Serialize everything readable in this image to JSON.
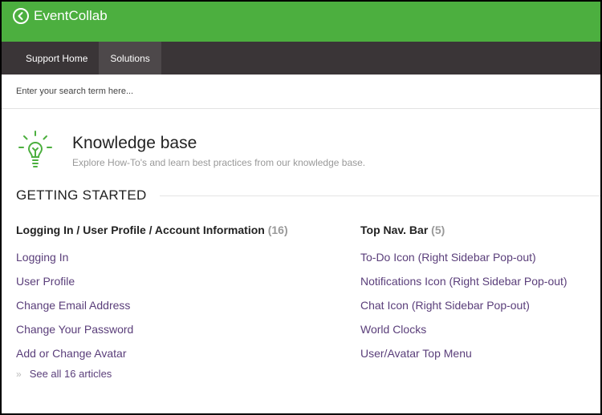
{
  "brand": {
    "name": "EventCollab"
  },
  "nav": {
    "items": [
      {
        "label": "Support Home"
      },
      {
        "label": "Solutions"
      }
    ]
  },
  "search": {
    "placeholder": "Enter your search term here..."
  },
  "kb": {
    "title": "Knowledge base",
    "subtitle": "Explore How-To's and learn best practices from our knowledge base."
  },
  "section": {
    "title": "GETTING STARTED"
  },
  "categories": [
    {
      "title": "Logging In / User Profile / Account Information",
      "count": "(16)",
      "articles": [
        "Logging In",
        "User Profile",
        "Change Email Address",
        "Change Your Password",
        "Add or Change Avatar"
      ],
      "see_all": "See all 16 articles"
    },
    {
      "title": "Top Nav. Bar",
      "count": "(5)",
      "articles": [
        "To-Do Icon (Right Sidebar Pop-out)",
        "Notifications Icon (Right Sidebar Pop-out)",
        "Chat Icon (Right Sidebar Pop-out)",
        "World Clocks",
        "User/Avatar Top Menu"
      ]
    }
  ],
  "colors": {
    "brand_green": "#4caf3f",
    "nav_dark": "#3a3537",
    "link_purple": "#5a3e7a"
  }
}
